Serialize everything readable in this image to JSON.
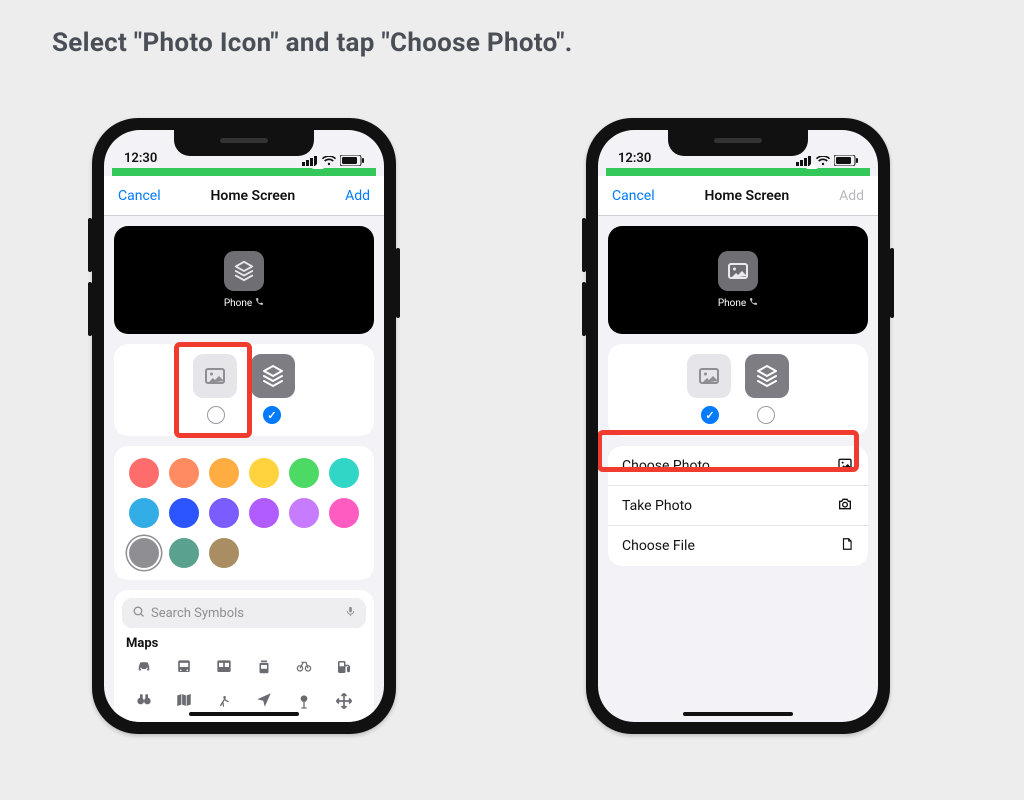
{
  "instruction": "Select \"Photo Icon\" and tap \"Choose Photo\".",
  "statusbar": {
    "time": "12:30"
  },
  "nav": {
    "cancel": "Cancel",
    "title": "Home Screen",
    "add": "Add"
  },
  "preview": {
    "app_name": "Phone"
  },
  "picker": {
    "photo_icon_label": "photo-icon",
    "glyph_icon_label": "glyph-icon"
  },
  "colors": [
    "#FF6C6C",
    "#FF8C61",
    "#FFAD42",
    "#FFD33D",
    "#4CD964",
    "#32D6C7",
    "#32ADE6",
    "#2D55FF",
    "#7A5CFF",
    "#B05CFF",
    "#C77CFF",
    "#FF5CC2",
    "#8E8E93",
    "#5BA190",
    "#A98E63"
  ],
  "search": {
    "placeholder": "Search Symbols",
    "section": "Maps"
  },
  "menu": {
    "choose_photo": "Choose Photo",
    "take_photo": "Take Photo",
    "choose_file": "Choose File"
  }
}
